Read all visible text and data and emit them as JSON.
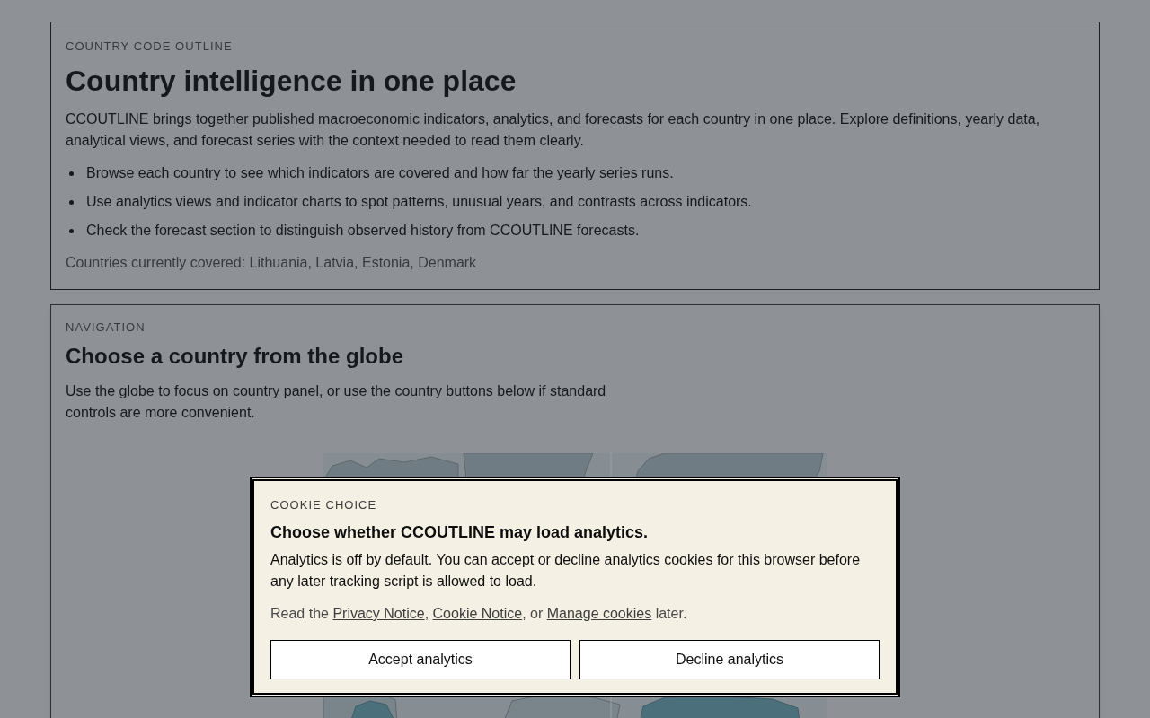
{
  "intro": {
    "eyebrow": "COUNTRY CODE OUTLINE",
    "title": "Country intelligence in one place",
    "description": "CCOUTLINE brings together published macroeconomic indicators, analytics, and forecasts for each country in one place. Explore definitions, yearly data, analytical views, and forecast series with the context needed to read them clearly.",
    "bullets": [
      "Browse each country to see which indicators are covered and how far the yearly series runs.",
      "Use analytics views and indicator charts to spot patterns, unusual years, and contrasts across indicators.",
      "Check the forecast section to distinguish observed history from CCOUTLINE forecasts."
    ],
    "coverage": "Countries currently covered: Lithuania, Latvia, Estonia, Denmark"
  },
  "navigation": {
    "eyebrow": "NAVIGATION",
    "title": "Choose a country from the globe",
    "description": "Use the globe to focus on country panel, or use the country buttons below if standard controls are more convenient."
  },
  "cookie_dialog": {
    "eyebrow": "COOKIE CHOICE",
    "title": "Choose whether CCOUTLINE may load analytics.",
    "description": "Analytics is off by default. You can accept or decline analytics cookies for this browser before any later tracking script is allowed to load.",
    "notice": [
      {
        "kind": "text",
        "text": "Read the "
      },
      {
        "kind": "link",
        "text": "Privacy Notice"
      },
      {
        "kind": "text",
        "text": ", "
      },
      {
        "kind": "link",
        "text": "Cookie Notice"
      },
      {
        "kind": "text",
        "text": ", or "
      },
      {
        "kind": "link",
        "text": "Manage cookies"
      },
      {
        "kind": "text",
        "text": " later."
      }
    ],
    "buttons": [
      "Accept analytics",
      "Decline analytics"
    ]
  }
}
